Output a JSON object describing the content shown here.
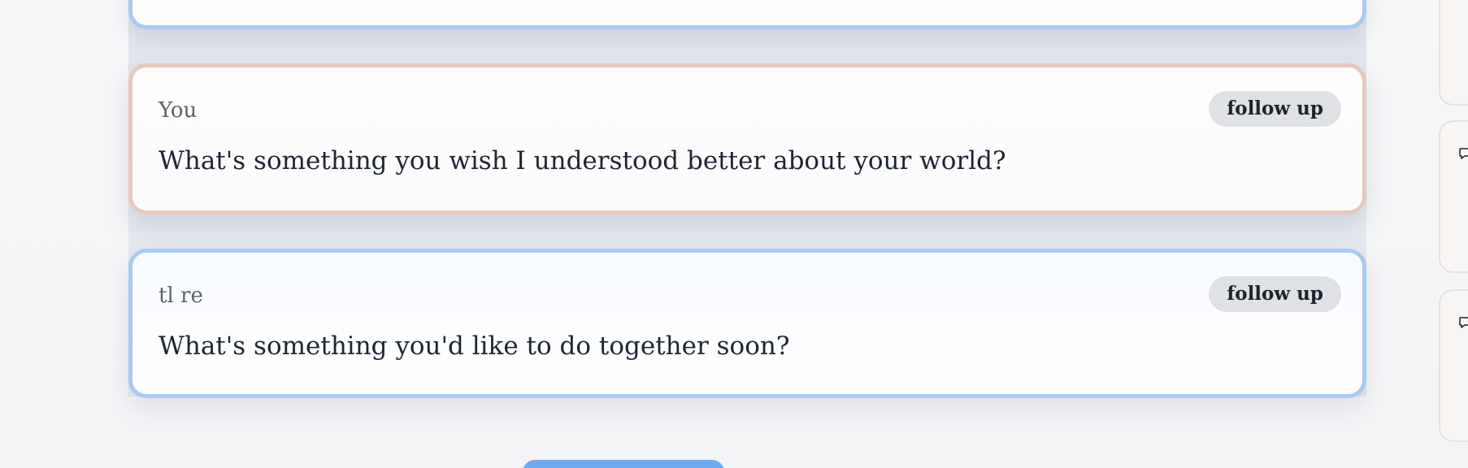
{
  "messages": [
    {
      "author": "You",
      "text": "What's something you wish I understood better about your world?",
      "action_label": "follow up"
    },
    {
      "author": "tl re",
      "text": "What's something you'd like to do together soon?",
      "action_label": "follow up"
    }
  ],
  "icons": {
    "side_comment": "comment-icon"
  },
  "colors": {
    "card_blue_border": "#a9cbf3",
    "card_peach_border": "#e6c8bd",
    "button_gray": "#dfe1e5",
    "primary_blue": "#6faaf1"
  }
}
